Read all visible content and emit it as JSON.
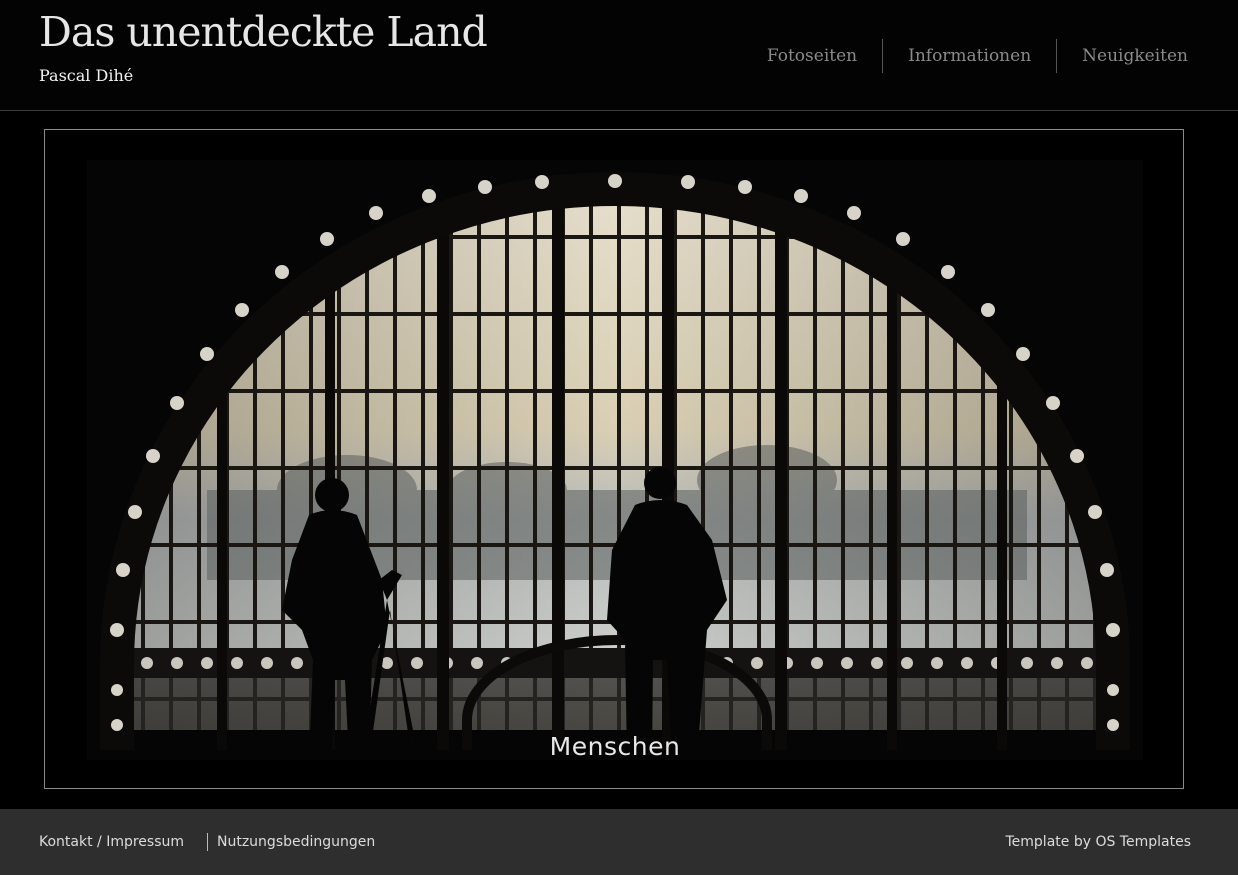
{
  "header": {
    "title": "Das unentdeckte Land",
    "author": "Pascal Dihé",
    "nav": [
      "Fotoseiten",
      "Informationen",
      "Neuigkeiten"
    ]
  },
  "slideshow": {
    "caption": "Menschen"
  },
  "footer": {
    "contact": "Kontakt / Impressum",
    "terms": "Nutzungsbedingungen",
    "credit": "Template by OS Templates"
  }
}
